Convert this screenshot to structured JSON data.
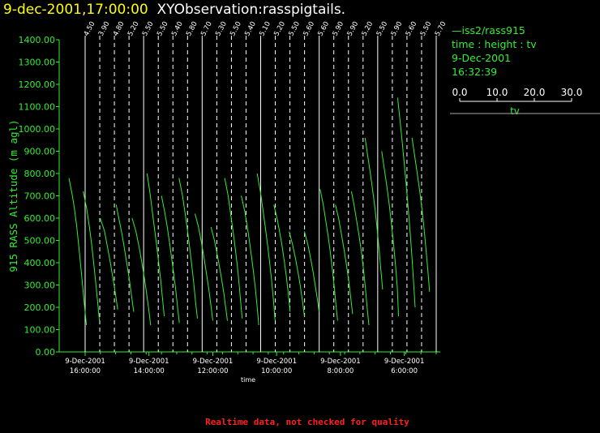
{
  "title": {
    "datetime": "9-dec-2001,17:00:00",
    "observation": "XYObservation:rasspigtails."
  },
  "legend": {
    "series_label": "—iss2/rass915",
    "variable": "time : height : tv",
    "date": "9-Dec-2001",
    "time": "16:32:39",
    "scale_ticks": [
      "0.0",
      "10.0",
      "20.0",
      "30.0"
    ],
    "scale_label": "tv"
  },
  "footer": "Realtime data, not checked for quality",
  "colors": {
    "series": "#33ee33",
    "axis": "#33ee33",
    "title_date": "#ffff00",
    "footer": "#ff2020",
    "grid": "#ffffff"
  },
  "chart_data": {
    "type": "line",
    "xlabel": "time",
    "ylabel": "915 RASS Altitude (m agl)",
    "ylim": [
      0,
      1400
    ],
    "y_ticks": [
      "0.00",
      "100.00",
      "200.00",
      "300.00",
      "400.00",
      "500.00",
      "600.00",
      "700.00",
      "800.00",
      "900.00",
      "1000.00",
      "1100.00",
      "1200.00",
      "1300.00",
      "1400.00"
    ],
    "x_ticks": [
      {
        "date": "9-Dec-2001",
        "time": "16:00:00",
        "hours_before_end": 0
      },
      {
        "date": "9-Dec-2001",
        "time": "14:00:00",
        "hours_before_end": 2
      },
      {
        "date": "9-Dec-2001",
        "time": "12:00:00",
        "hours_before_end": 4
      },
      {
        "date": "9-Dec-2001",
        "time": "10:00:00",
        "hours_before_end": 6
      },
      {
        "date": "9-Dec-2001",
        "time": "8:00:00",
        "hours_before_end": 8
      },
      {
        "date": "9-Dec-2001",
        "time": "6:00:00",
        "hours_before_end": 10
      }
    ],
    "profile_labels": [
      "4.50",
      "3.90",
      "4.80",
      "5.20",
      "5.50",
      "5.50",
      "5.40",
      "5.80",
      "5.70",
      "5.30",
      "5.50",
      "5.40",
      "5.10",
      "5.20",
      "5.50",
      "5.60",
      "5.60",
      "5.90",
      "5.90",
      "5.20",
      "5.50",
      "5.90",
      "5.60",
      "5.50",
      "5.70"
    ],
    "profiles": [
      {
        "x": 0.0,
        "values": [
          [
            780,
            0.0
          ],
          [
            700,
            2.0
          ],
          [
            640,
            3.2
          ],
          [
            560,
            4.5
          ],
          [
            470,
            5.7
          ],
          [
            380,
            6.8
          ],
          [
            290,
            7.9
          ],
          [
            200,
            9.0
          ],
          [
            120,
            10.0
          ]
        ]
      },
      {
        "x": 0.45,
        "values": [
          [
            720,
            0.0
          ],
          [
            640,
            2.0
          ],
          [
            560,
            3.5
          ],
          [
            480,
            4.8
          ],
          [
            400,
            5.9
          ],
          [
            320,
            7.0
          ],
          [
            240,
            8.0
          ],
          [
            140,
            9.2
          ]
        ]
      },
      {
        "x": 0.98,
        "values": [
          [
            600,
            0.0
          ],
          [
            540,
            2.5
          ],
          [
            470,
            4.2
          ],
          [
            400,
            5.8
          ],
          [
            330,
            7.3
          ],
          [
            260,
            8.7
          ],
          [
            190,
            10.0
          ]
        ]
      },
      {
        "x": 1.48,
        "values": [
          [
            660,
            0.0
          ],
          [
            600,
            1.5
          ],
          [
            530,
            3.3
          ],
          [
            460,
            4.8
          ],
          [
            390,
            6.2
          ],
          [
            320,
            7.6
          ],
          [
            250,
            8.8
          ],
          [
            180,
            10.0
          ]
        ]
      },
      {
        "x": 1.98,
        "values": [
          [
            600,
            0.0
          ],
          [
            540,
            2.2
          ],
          [
            470,
            4.0
          ],
          [
            400,
            5.6
          ],
          [
            330,
            7.0
          ],
          [
            260,
            8.3
          ],
          [
            190,
            9.5
          ],
          [
            120,
            10.6
          ]
        ]
      },
      {
        "x": 2.45,
        "values": [
          [
            800,
            0.0
          ],
          [
            720,
            1.5
          ],
          [
            640,
            2.8
          ],
          [
            560,
            4.1
          ],
          [
            480,
            5.4
          ],
          [
            400,
            6.6
          ],
          [
            320,
            7.8
          ],
          [
            240,
            8.8
          ],
          [
            160,
            9.8
          ]
        ]
      },
      {
        "x": 2.9,
        "values": [
          [
            700,
            0.0
          ],
          [
            630,
            1.8
          ],
          [
            560,
            3.3
          ],
          [
            490,
            4.6
          ],
          [
            420,
            5.8
          ],
          [
            350,
            7.0
          ],
          [
            280,
            8.1
          ],
          [
            200,
            9.2
          ],
          [
            130,
            10.2
          ]
        ]
      },
      {
        "x": 3.45,
        "values": [
          [
            780,
            0.0
          ],
          [
            700,
            2.0
          ],
          [
            620,
            3.5
          ],
          [
            540,
            4.9
          ],
          [
            460,
            6.2
          ],
          [
            380,
            7.4
          ],
          [
            300,
            8.5
          ],
          [
            220,
            9.5
          ],
          [
            150,
            10.5
          ]
        ]
      },
      {
        "x": 3.95,
        "values": [
          [
            620,
            0.0
          ],
          [
            560,
            2.0
          ],
          [
            490,
            3.7
          ],
          [
            420,
            5.2
          ],
          [
            350,
            6.6
          ],
          [
            280,
            7.9
          ],
          [
            210,
            9.1
          ],
          [
            140,
            10.2
          ]
        ]
      },
      {
        "x": 4.45,
        "values": [
          [
            560,
            0.0
          ],
          [
            500,
            2.0
          ],
          [
            440,
            3.5
          ],
          [
            380,
            4.9
          ],
          [
            320,
            6.2
          ],
          [
            260,
            7.4
          ],
          [
            200,
            8.4
          ],
          [
            140,
            9.4
          ]
        ]
      },
      {
        "x": 4.88,
        "values": [
          [
            780,
            0.0
          ],
          [
            700,
            2.0
          ],
          [
            620,
            3.4
          ],
          [
            540,
            4.8
          ],
          [
            460,
            6.1
          ],
          [
            380,
            7.3
          ],
          [
            300,
            8.3
          ],
          [
            210,
            9.3
          ],
          [
            150,
            10.0
          ]
        ]
      },
      {
        "x": 5.4,
        "values": [
          [
            700,
            0.0
          ],
          [
            630,
            2.0
          ],
          [
            560,
            3.5
          ],
          [
            490,
            4.8
          ],
          [
            420,
            6.0
          ],
          [
            350,
            7.1
          ],
          [
            280,
            8.1
          ],
          [
            200,
            9.1
          ],
          [
            120,
            10.0
          ]
        ]
      },
      {
        "x": 5.9,
        "values": [
          [
            800,
            0.0
          ],
          [
            720,
            1.8
          ],
          [
            640,
            3.2
          ],
          [
            560,
            4.6
          ],
          [
            480,
            5.9
          ],
          [
            400,
            7.1
          ],
          [
            320,
            8.2
          ],
          [
            230,
            9.3
          ],
          [
            140,
            10.2
          ]
        ]
      },
      {
        "x": 6.42,
        "values": [
          [
            660,
            0.0
          ],
          [
            600,
            1.8
          ],
          [
            540,
            3.3
          ],
          [
            480,
            4.6
          ],
          [
            410,
            5.9
          ],
          [
            340,
            7.1
          ],
          [
            260,
            8.3
          ],
          [
            180,
            9.3
          ]
        ]
      },
      {
        "x": 6.9,
        "values": [
          [
            540,
            0.0
          ],
          [
            480,
            2.0
          ],
          [
            420,
            3.6
          ],
          [
            360,
            5.0
          ],
          [
            300,
            6.3
          ],
          [
            230,
            7.6
          ],
          [
            160,
            8.7
          ]
        ]
      },
      {
        "x": 7.38,
        "values": [
          [
            540,
            0.0
          ],
          [
            480,
            2.0
          ],
          [
            420,
            3.5
          ],
          [
            360,
            4.9
          ],
          [
            300,
            6.1
          ],
          [
            240,
            7.3
          ],
          [
            180,
            8.4
          ]
        ]
      },
      {
        "x": 7.87,
        "values": [
          [
            730,
            0.0
          ],
          [
            660,
            1.8
          ],
          [
            590,
            3.2
          ],
          [
            520,
            4.6
          ],
          [
            450,
            5.8
          ],
          [
            370,
            7.0
          ],
          [
            290,
            8.1
          ],
          [
            210,
            9.1
          ],
          [
            140,
            10.0
          ]
        ]
      },
      {
        "x": 8.35,
        "values": [
          [
            660,
            0.0
          ],
          [
            600,
            1.8
          ],
          [
            530,
            3.4
          ],
          [
            460,
            4.9
          ],
          [
            390,
            6.3
          ],
          [
            320,
            7.6
          ],
          [
            240,
            8.8
          ],
          [
            170,
            9.8
          ]
        ]
      },
      {
        "x": 8.85,
        "values": [
          [
            720,
            0.0
          ],
          [
            660,
            1.5
          ],
          [
            590,
            3.0
          ],
          [
            520,
            4.4
          ],
          [
            450,
            5.7
          ],
          [
            370,
            6.9
          ],
          [
            290,
            8.0
          ],
          [
            200,
            9.0
          ],
          [
            120,
            10.0
          ]
        ]
      },
      {
        "x": 9.28,
        "values": [
          [
            960,
            0.0
          ],
          [
            880,
            1.5
          ],
          [
            800,
            3.0
          ],
          [
            720,
            4.4
          ],
          [
            640,
            5.7
          ],
          [
            550,
            6.9
          ],
          [
            460,
            8.0
          ],
          [
            370,
            9.0
          ],
          [
            280,
            10.0
          ]
        ]
      },
      {
        "x": 9.8,
        "values": [
          [
            900,
            0.0
          ],
          [
            820,
            1.5
          ],
          [
            740,
            3.0
          ],
          [
            660,
            4.3
          ],
          [
            570,
            5.6
          ],
          [
            480,
            6.8
          ],
          [
            390,
            7.9
          ],
          [
            290,
            8.9
          ],
          [
            160,
            9.6
          ]
        ]
      },
      {
        "x": 10.3,
        "values": [
          [
            1140,
            0.0
          ],
          [
            1040,
            1.3
          ],
          [
            940,
            2.6
          ],
          [
            840,
            3.8
          ],
          [
            740,
            5.0
          ],
          [
            640,
            6.1
          ],
          [
            530,
            7.2
          ],
          [
            420,
            8.2
          ],
          [
            300,
            9.2
          ],
          [
            200,
            10.0
          ]
        ]
      },
      {
        "x": 10.75,
        "values": [
          [
            960,
            0.0
          ],
          [
            880,
            1.5
          ],
          [
            800,
            3.0
          ],
          [
            720,
            4.4
          ],
          [
            640,
            5.7
          ],
          [
            550,
            6.9
          ],
          [
            460,
            8.0
          ],
          [
            370,
            9.0
          ],
          [
            270,
            10.0
          ]
        ]
      }
    ]
  }
}
